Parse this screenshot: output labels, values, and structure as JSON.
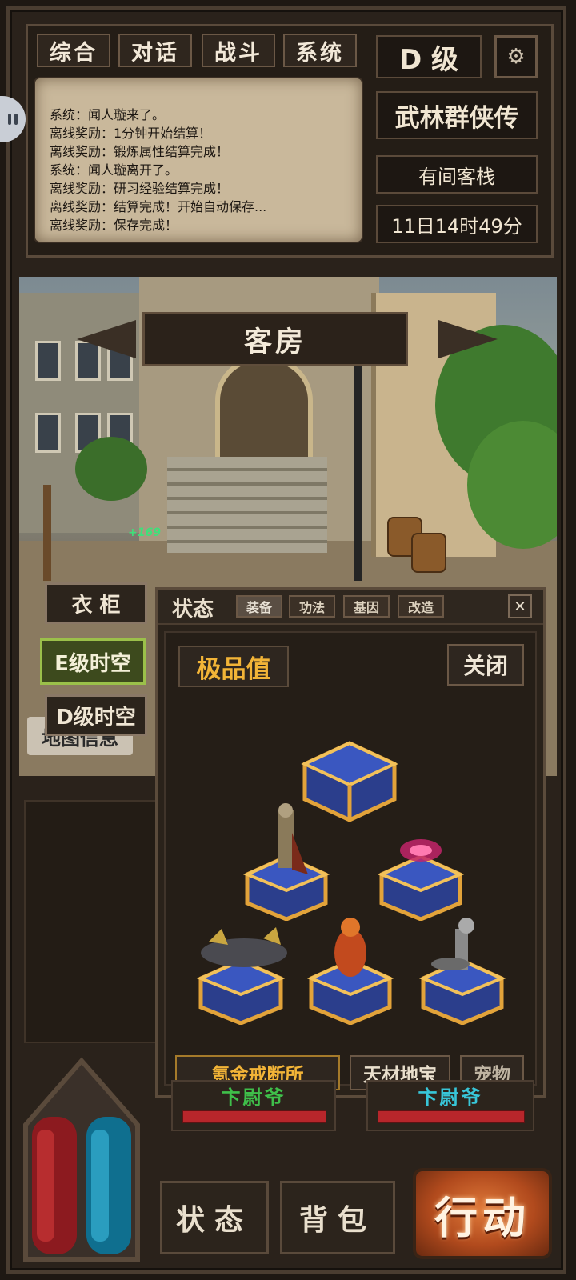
{
  "chat_tabs": [
    "综合",
    "对话",
    "战斗",
    "系统"
  ],
  "log_lines": [
    "系统：闻人璇来了。",
    "离线奖励：1分钟开始结算！",
    "离线奖励：锻炼属性结算完成！",
    "系统：闻人璇离开了。",
    "离线奖励：研习经验结算完成！",
    "离线奖励：结算完成！开始自动保存...",
    "离线奖励：保存完成！"
  ],
  "rank": "D 级",
  "game_title": "武林群侠传",
  "location": "有间客栈",
  "game_time": "11日14时49分",
  "room_name": "客房",
  "floating_value": "+169",
  "nav_buttons": [
    "衣 柜",
    "E级时空",
    "D级时空"
  ],
  "map_info": "地图信息",
  "status_window": {
    "title": "状态",
    "tabs": [
      "装备",
      "功法",
      "基因",
      "改造"
    ],
    "close_x": "✕",
    "quality_label": "极品值",
    "close_label": "关闭",
    "bottom_tabs": [
      "氪金戒断所",
      "天材地宝",
      "宠物"
    ]
  },
  "hud": {
    "left_name": "卞尉爷",
    "right_name": "卞尉爷",
    "left_hp": 1.0,
    "right_hp": 1.0
  },
  "bottom_buttons": {
    "status": "状态",
    "bag": "背包",
    "action": "行动"
  },
  "colors": {
    "accent_gold": "#f2b437",
    "active_green": "#9bc04a",
    "hp_red": "#b8262b",
    "name_green": "#3fbf4a",
    "name_cyan": "#38c6d8"
  }
}
